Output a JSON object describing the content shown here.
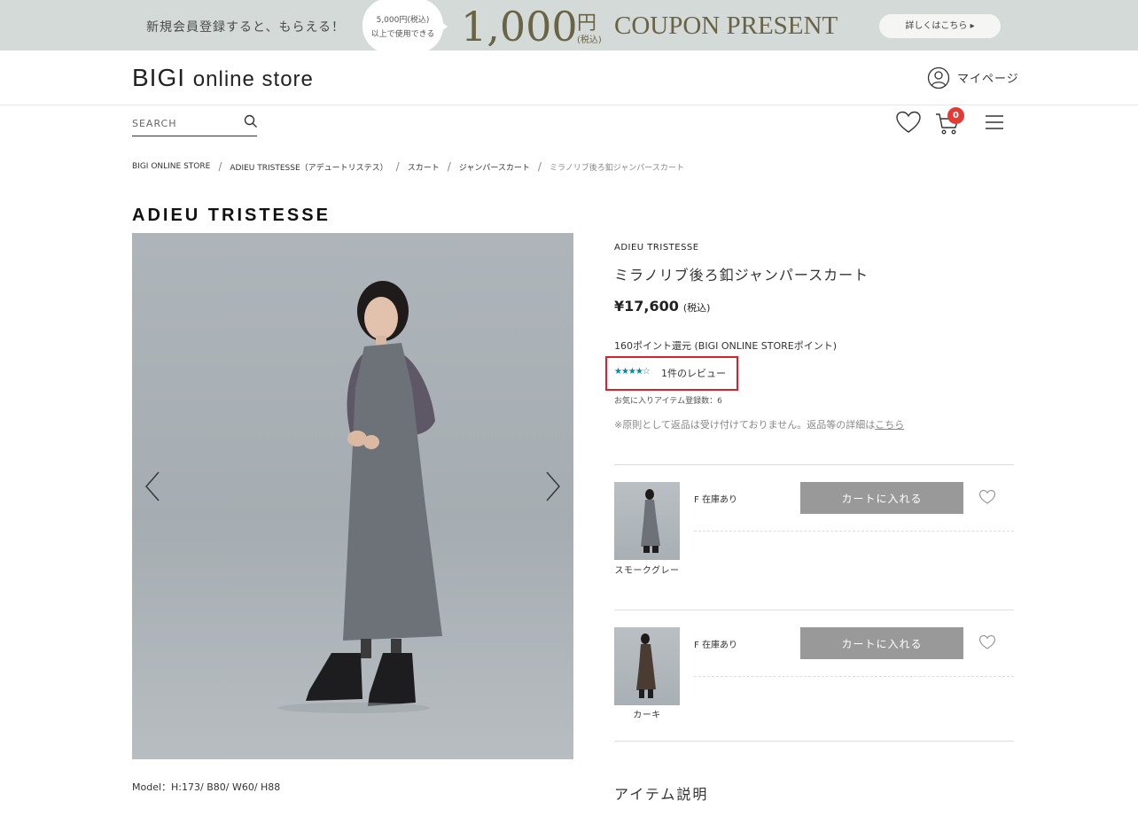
{
  "banner": {
    "lead": "新規会員登録すると、もらえる！",
    "cond_line1": "5,000円(税込)",
    "cond_line2": "以上で使用できる",
    "amount": "1,000",
    "yen": "円",
    "tax": "(税込)",
    "coupon": "COUPON PRESENT",
    "details_button": "詳しくはこちら ▸"
  },
  "header": {
    "logo_main": "BIGI",
    "logo_sub": "online store",
    "mypage": "マイページ",
    "search_placeholder": "SEARCH",
    "cart_count": "0"
  },
  "breadcrumb": {
    "items": [
      "BIGI ONLINE STORE",
      "ADIEU TRISTESSE（アデュートリステス）",
      "スカート",
      "ジャンパースカート"
    ],
    "current": "ミラノリブ後ろ釦ジャンパースカート",
    "separator": "/"
  },
  "brand_title": "ADIEU TRISTESSE",
  "model_info": "Model：H:173/ B80/ W60/ H88",
  "product": {
    "brand": "ADIEU TRISTESSE",
    "name": "ミラノリブ後ろ釦ジャンパースカート",
    "price": "¥17,600",
    "price_tax": "(税込)",
    "points": "160ポイント還元 (BIGI ONLINE STOREポイント)",
    "rating": 4,
    "rating_max": 5,
    "rating_stars": "★★★★☆",
    "review_count": "1件のレビュー",
    "favorites": "お気に入りアイテム登録数：6",
    "return_note": "※原則として返品は受け付けておりません。返品等の詳細は",
    "return_link": "こちら"
  },
  "variants": [
    {
      "color": "スモークグレー",
      "size": "F",
      "stock": "在庫あり",
      "cart_label": "カートに入れる"
    },
    {
      "color": "カーキ",
      "size": "F",
      "stock": "在庫あり",
      "cart_label": "カートに入れる"
    }
  ],
  "item_description_heading": "アイテム説明",
  "colors": {
    "banner_bg": "#d4dad8",
    "banner_gold": "#6a6446",
    "cart_badge": "#e53935",
    "review_star": "#0088aa",
    "review_highlight": "#d9202f",
    "cart_button": "#999999"
  }
}
